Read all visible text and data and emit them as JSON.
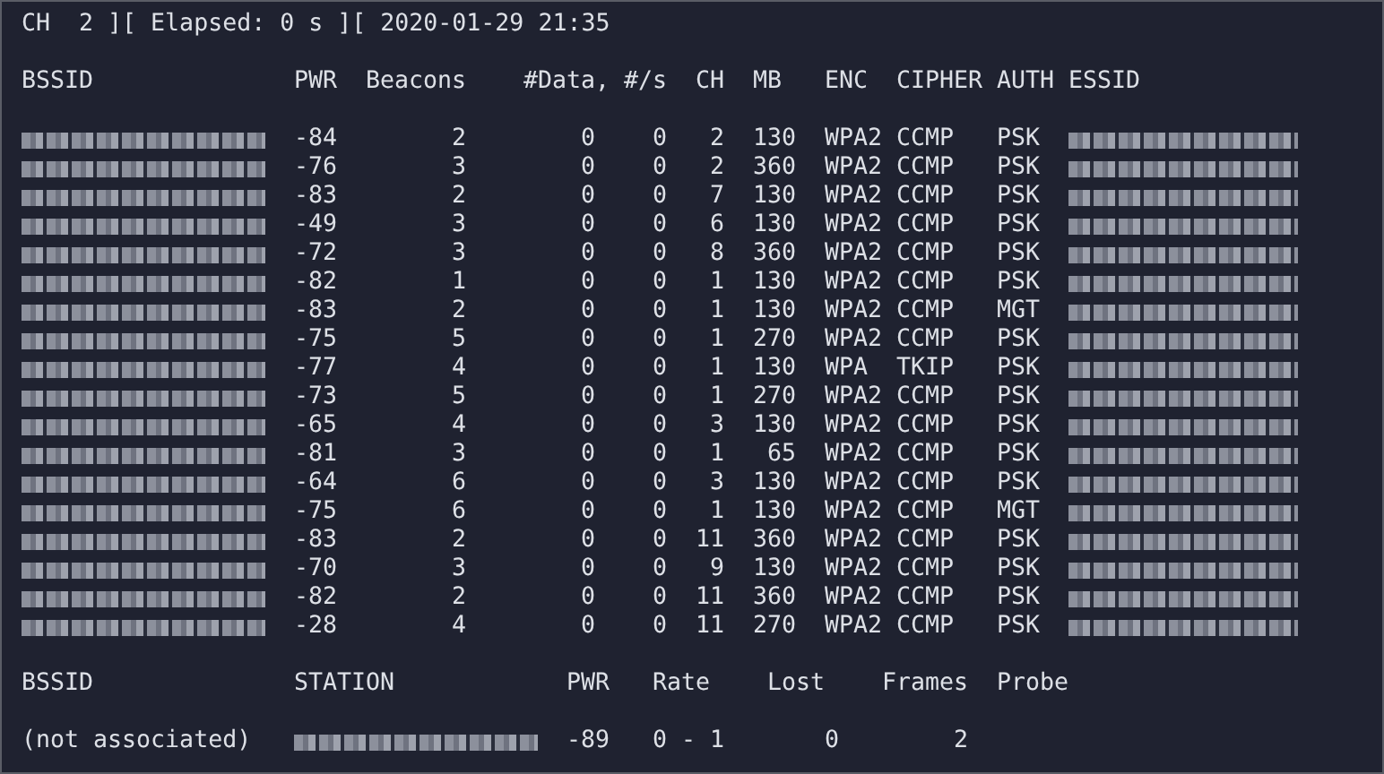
{
  "status_line": "CH  2 ][ Elapsed: 0 s ][ 2020-01-29 21:35",
  "access_points": {
    "columns": [
      "BSSID",
      "PWR",
      "Beacons",
      "#Data,",
      "#/s",
      "CH",
      "MB",
      "ENC",
      "CIPHER",
      "AUTH",
      "ESSID"
    ],
    "rows": [
      {
        "pwr": "-84",
        "beacons": "2",
        "data": "0",
        "per_s": "0",
        "ch": "2",
        "mb": "130",
        "enc": "WPA2",
        "cipher": "CCMP",
        "auth": "PSK"
      },
      {
        "pwr": "-76",
        "beacons": "3",
        "data": "0",
        "per_s": "0",
        "ch": "2",
        "mb": "360",
        "enc": "WPA2",
        "cipher": "CCMP",
        "auth": "PSK"
      },
      {
        "pwr": "-83",
        "beacons": "2",
        "data": "0",
        "per_s": "0",
        "ch": "7",
        "mb": "130",
        "enc": "WPA2",
        "cipher": "CCMP",
        "auth": "PSK"
      },
      {
        "pwr": "-49",
        "beacons": "3",
        "data": "0",
        "per_s": "0",
        "ch": "6",
        "mb": "130",
        "enc": "WPA2",
        "cipher": "CCMP",
        "auth": "PSK"
      },
      {
        "pwr": "-72",
        "beacons": "3",
        "data": "0",
        "per_s": "0",
        "ch": "8",
        "mb": "360",
        "enc": "WPA2",
        "cipher": "CCMP",
        "auth": "PSK"
      },
      {
        "pwr": "-82",
        "beacons": "1",
        "data": "0",
        "per_s": "0",
        "ch": "1",
        "mb": "130",
        "enc": "WPA2",
        "cipher": "CCMP",
        "auth": "PSK"
      },
      {
        "pwr": "-83",
        "beacons": "2",
        "data": "0",
        "per_s": "0",
        "ch": "1",
        "mb": "130",
        "enc": "WPA2",
        "cipher": "CCMP",
        "auth": "MGT"
      },
      {
        "pwr": "-75",
        "beacons": "5",
        "data": "0",
        "per_s": "0",
        "ch": "1",
        "mb": "270",
        "enc": "WPA2",
        "cipher": "CCMP",
        "auth": "PSK"
      },
      {
        "pwr": "-77",
        "beacons": "4",
        "data": "0",
        "per_s": "0",
        "ch": "1",
        "mb": "130",
        "enc": "WPA",
        "cipher": "TKIP",
        "auth": "PSK"
      },
      {
        "pwr": "-73",
        "beacons": "5",
        "data": "0",
        "per_s": "0",
        "ch": "1",
        "mb": "270",
        "enc": "WPA2",
        "cipher": "CCMP",
        "auth": "PSK"
      },
      {
        "pwr": "-65",
        "beacons": "4",
        "data": "0",
        "per_s": "0",
        "ch": "3",
        "mb": "130",
        "enc": "WPA2",
        "cipher": "CCMP",
        "auth": "PSK"
      },
      {
        "pwr": "-81",
        "beacons": "3",
        "data": "0",
        "per_s": "0",
        "ch": "1",
        "mb": "65",
        "enc": "WPA2",
        "cipher": "CCMP",
        "auth": "PSK"
      },
      {
        "pwr": "-64",
        "beacons": "6",
        "data": "0",
        "per_s": "0",
        "ch": "3",
        "mb": "130",
        "enc": "WPA2",
        "cipher": "CCMP",
        "auth": "PSK"
      },
      {
        "pwr": "-75",
        "beacons": "6",
        "data": "0",
        "per_s": "0",
        "ch": "1",
        "mb": "130",
        "enc": "WPA2",
        "cipher": "CCMP",
        "auth": "MGT"
      },
      {
        "pwr": "-83",
        "beacons": "2",
        "data": "0",
        "per_s": "0",
        "ch": "11",
        "mb": "360",
        "enc": "WPA2",
        "cipher": "CCMP",
        "auth": "PSK"
      },
      {
        "pwr": "-70",
        "beacons": "3",
        "data": "0",
        "per_s": "0",
        "ch": "9",
        "mb": "130",
        "enc": "WPA2",
        "cipher": "CCMP",
        "auth": "PSK"
      },
      {
        "pwr": "-82",
        "beacons": "2",
        "data": "0",
        "per_s": "0",
        "ch": "11",
        "mb": "360",
        "enc": "WPA2",
        "cipher": "CCMP",
        "auth": "PSK"
      },
      {
        "pwr": "-28",
        "beacons": "4",
        "data": "0",
        "per_s": "0",
        "ch": "11",
        "mb": "270",
        "enc": "WPA2",
        "cipher": "CCMP",
        "auth": "PSK"
      }
    ]
  },
  "stations": {
    "columns": [
      "BSSID",
      "STATION",
      "PWR",
      "Rate",
      "Lost",
      "Frames",
      "Probe"
    ],
    "rows": [
      {
        "bssid": "(not associated)",
        "pwr": "-89",
        "rate": "0 - 1",
        "lost": "0",
        "frames": "2"
      }
    ]
  }
}
